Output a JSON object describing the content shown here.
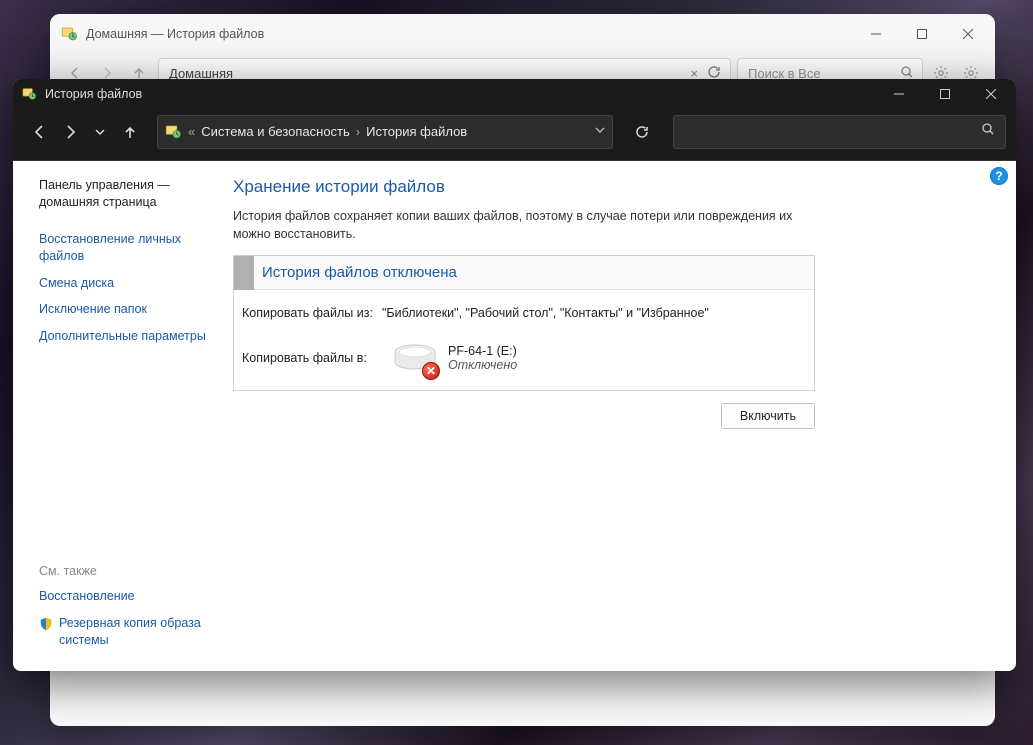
{
  "backWindow": {
    "title": "Домашняя — История файлов",
    "address": "Домашняя",
    "searchPlaceholder": "Поиск в Все"
  },
  "frontWindow": {
    "title": "История файлов",
    "breadcrumb": {
      "prefix": "«",
      "part1": "Система и безопасность",
      "part2": "История файлов"
    }
  },
  "sidebar": {
    "home": "Панель управления — домашняя страница",
    "links": {
      "restorePersonal": "Восстановление личных файлов",
      "changeDrive": "Смена диска",
      "excludeFolders": "Исключение папок",
      "advanced": "Дополнительные параметры"
    },
    "seeAlso": "См. также",
    "recovery": "Восстановление",
    "systemImage": "Резервная копия образа системы"
  },
  "content": {
    "heading": "Хранение истории файлов",
    "description": "История файлов сохраняет копии ваших файлов, поэтому в случае потери или повреждения их можно восстановить.",
    "statusTitle": "История файлов отключена",
    "copyFromLabel": "Копировать файлы из:",
    "copyFromValue": "\"Библиотеки\", \"Рабочий стол\", \"Контакты\" и \"Избранное\"",
    "copyToLabel": "Копировать файлы в:",
    "driveName": "PF-64-1 (E:)",
    "driveState": "Отключено",
    "enableButton": "Включить"
  },
  "colors": {
    "link": "#1a5aa8",
    "darkBar": "#1b1b1b"
  }
}
